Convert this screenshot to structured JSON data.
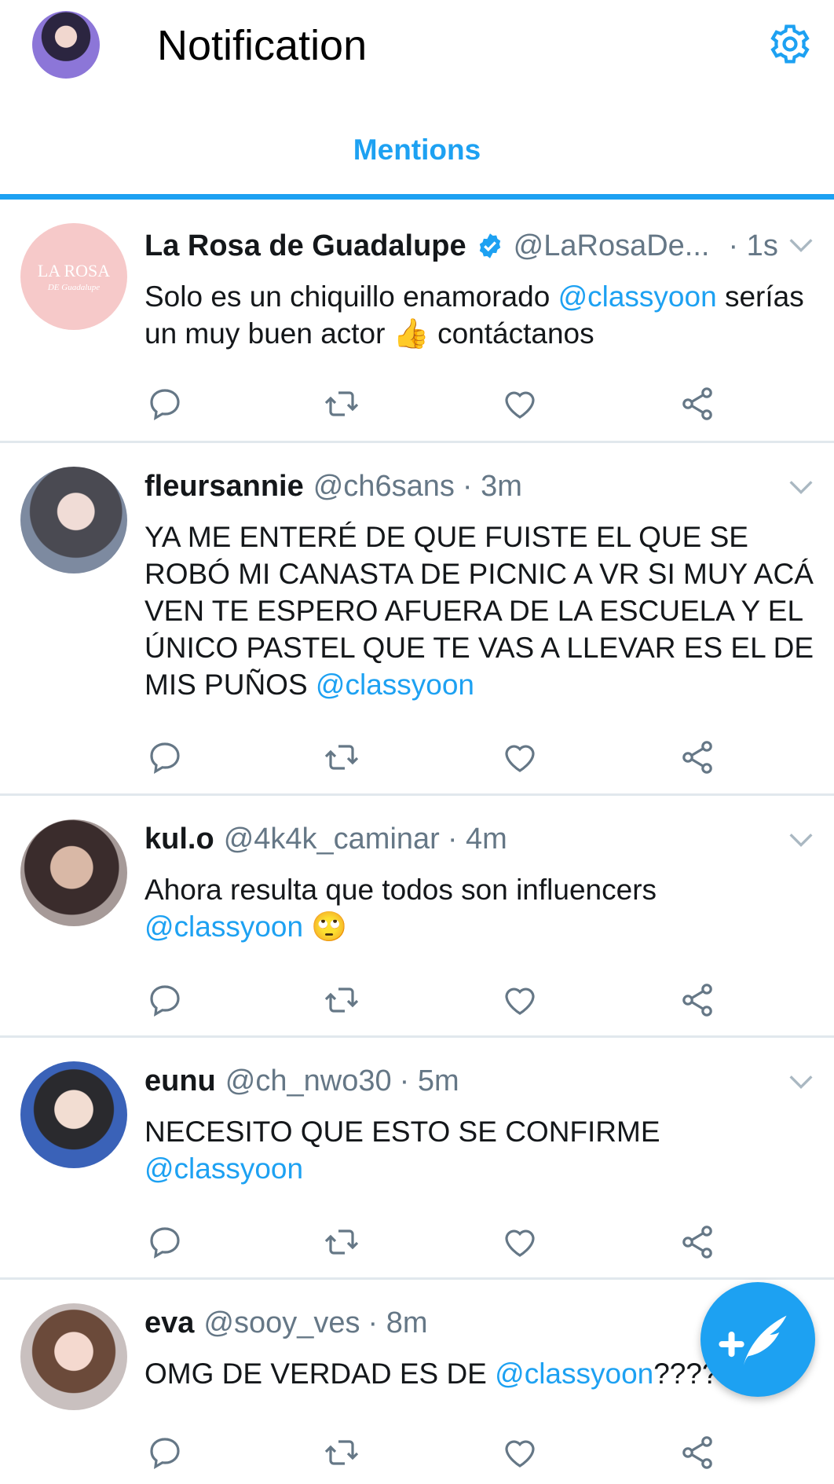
{
  "header": {
    "title": "Notification",
    "tab_label": "Mentions"
  },
  "colors": {
    "accent": "#1da1f2",
    "text_primary": "#14171a",
    "text_secondary": "#657786",
    "divider": "#e1e8ed"
  },
  "icons": {
    "settings": "gear-icon",
    "reply": "comment-icon",
    "retweet": "retweet-icon",
    "like": "heart-icon",
    "share": "share-icon",
    "more": "chevron-down-icon",
    "verified": "verified-badge-icon",
    "compose": "compose-tweet-icon"
  },
  "tweets": [
    {
      "avatar_text_1": "LA ROSA",
      "avatar_text_2": "DE Guadalupe",
      "name": "La Rosa de Guadalupe",
      "handle": "@LaRosaDe...",
      "time": "· 1s",
      "text_a": "Solo es un chiquillo enamorado ",
      "mention": "@classyoon",
      "text_b": " serías un muy buen actor 👍 contáctanos"
    },
    {
      "name": "fleursannie",
      "handle": "@ch6sans",
      "time": "· 3m",
      "text_a": "YA ME ENTERÉ DE QUE FUISTE EL QUE SE ROBÓ MI CANASTA DE PICNIC A VR SI MUY ACÁ VEN TE ESPERO AFUERA DE LA ESCUELA Y EL ÚNICO PASTEL QUE TE VAS A LLEVAR ES EL DE MIS PUÑOS ",
      "mention": "@classyoon",
      "text_b": ""
    },
    {
      "name": "kul.o",
      "handle": "@4k4k_caminar",
      "time": "· 4m",
      "text_a": "Ahora resulta que todos son influencers ",
      "mention": "@classyoon",
      "text_b": " 🙄"
    },
    {
      "name": "eunu",
      "handle": "@ch_nwo30",
      "time": "· 5m",
      "text_a": "NECESITO QUE ESTO SE CONFIRME ",
      "mention": "@classyoon",
      "text_b": ""
    },
    {
      "name": "eva",
      "handle": "@sooy_ves",
      "time": "· 8m",
      "text_a": "OMG DE VERDAD ES DE ",
      "mention": "@classyoon",
      "text_b": "????"
    }
  ]
}
